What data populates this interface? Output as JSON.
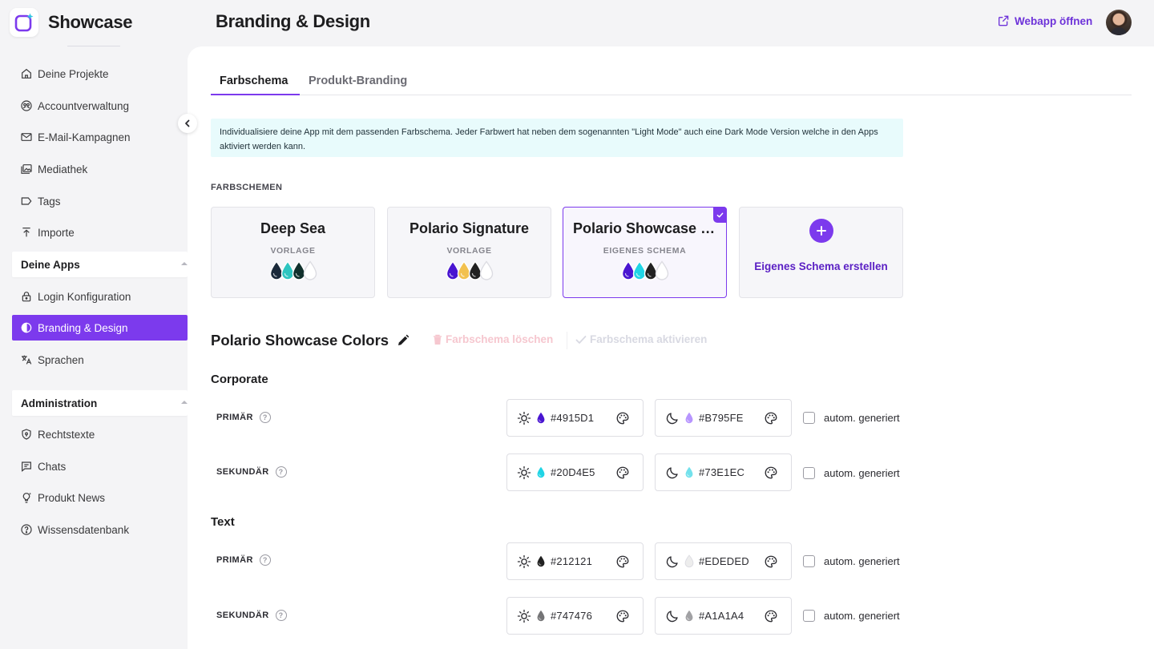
{
  "app": {
    "name": "Showcase"
  },
  "sidebar": {
    "items": [
      {
        "label": "Deine Projekte",
        "icon": "home-icon"
      },
      {
        "label": "Accountverwaltung",
        "icon": "users-icon"
      },
      {
        "label": "E-Mail-Kampagnen",
        "icon": "mail-icon"
      },
      {
        "label": "Mediathek",
        "icon": "media-icon"
      },
      {
        "label": "Tags",
        "icon": "tag-icon"
      },
      {
        "label": "Importe",
        "icon": "import-icon"
      }
    ],
    "section_apps": "Deine Apps",
    "app_items": [
      {
        "label": "Login Konfiguration",
        "icon": "lock-icon"
      },
      {
        "label": "Branding & Design",
        "icon": "contrast-icon",
        "active": true
      },
      {
        "label": "Sprachen",
        "icon": "translate-icon"
      }
    ],
    "section_admin": "Administration",
    "admin_items": [
      {
        "label": "Rechtstexte",
        "icon": "shield-icon"
      },
      {
        "label": "Chats",
        "icon": "chat-icon"
      },
      {
        "label": "Produkt News",
        "icon": "bulb-icon"
      },
      {
        "label": "Wissensdatenbank",
        "icon": "help-circle-icon"
      }
    ]
  },
  "header": {
    "title": "Branding & Design",
    "webapp_link": "Webapp öffnen"
  },
  "tabs": [
    "Farbschema",
    "Produkt-Branding"
  ],
  "info_text": "Individualisiere deine App mit dem passenden Farbschema. Jeder Farbwert hat neben dem sogenannten \"Light Mode\" auch eine Dark Mode Version welche in den Apps aktiviert werden kann.",
  "schemes_label": "FARBSCHEMEN",
  "schemes": [
    {
      "name": "Deep Sea",
      "type": "VORLAGE",
      "drops": [
        "#1b2a3a",
        "#2dc5c0",
        "#10302c",
        "#ffffff"
      ]
    },
    {
      "name": "Polario Signature",
      "type": "VORLAGE",
      "drops": [
        "#4915D1",
        "#f2c14e",
        "#212121",
        "#ffffff"
      ]
    },
    {
      "name": "Polario Showcase Colors",
      "type": "EIGENES SCHEMA",
      "drops": [
        "#4915D1",
        "#20D4E5",
        "#212121",
        "#ffffff"
      ],
      "selected": true
    }
  ],
  "create_scheme": "Eigenes Schema erstellen",
  "current_scheme": {
    "title": "Polario Showcase Colors",
    "delete_label": "Farbschema löschen",
    "activate_label": "Farbschema aktivieren"
  },
  "groups": [
    {
      "title": "Corporate",
      "rows": [
        {
          "label": "PRIMÄR",
          "light": "#4915D1",
          "dark": "#B795FE",
          "auto": "autom. generiert"
        },
        {
          "label": "SEKUNDÄR",
          "light": "#20D4E5",
          "dark": "#73E1EC",
          "auto": "autom. generiert"
        }
      ]
    },
    {
      "title": "Text",
      "rows": [
        {
          "label": "PRIMÄR",
          "light": "#212121",
          "dark": "#EDEDED",
          "auto": "autom. generiert"
        },
        {
          "label": "SEKUNDÄR",
          "light": "#747476",
          "dark": "#A1A1A4",
          "auto": "autom. generiert"
        }
      ]
    }
  ],
  "colors": {
    "accent": "#7c3aed"
  }
}
